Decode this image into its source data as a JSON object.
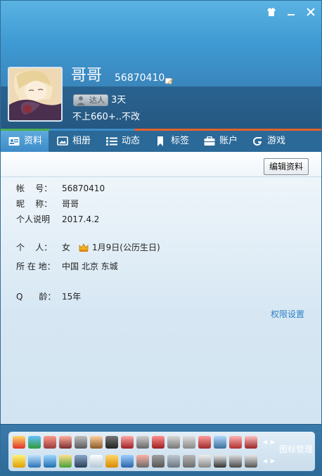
{
  "profile": {
    "nickname": "哥哥",
    "qq_number": "56870410",
    "level_label": "达人",
    "days": "3天",
    "signature": "不上660+..不改"
  },
  "tabs": [
    {
      "label": "资料",
      "icon": "profile-card-icon"
    },
    {
      "label": "相册",
      "icon": "album-icon"
    },
    {
      "label": "动态",
      "icon": "feed-list-icon"
    },
    {
      "label": "标签",
      "icon": "bookmark-icon"
    },
    {
      "label": "账户",
      "icon": "briefcase-icon"
    },
    {
      "label": "游戏",
      "icon": "game-icon"
    }
  ],
  "toolbar": {
    "edit_label": "编辑资料"
  },
  "info": {
    "account_key": "帐    号：",
    "account_val": "56870410",
    "nick_key": "昵    称：",
    "nick_val": "哥哥",
    "desc_key": "个人说明",
    "desc_val": "2017.4.2",
    "personal_key": "个    人：",
    "gender": "女",
    "birthday": "1月9日(公历生日)",
    "location_key": "所 在 地：",
    "location_val": "中国 北京 东城",
    "age_key": "Q      龄：",
    "age_val": "15年"
  },
  "links": {
    "permission": "权限设置"
  },
  "bottom": {
    "manage_label": "图标管理"
  },
  "colors": {
    "header_top": "#5ab3e2",
    "tab_bar": "#2a6998",
    "link": "#2f7fc6",
    "accent_green": "#4caf50",
    "accent_orange": "#e8612c"
  }
}
